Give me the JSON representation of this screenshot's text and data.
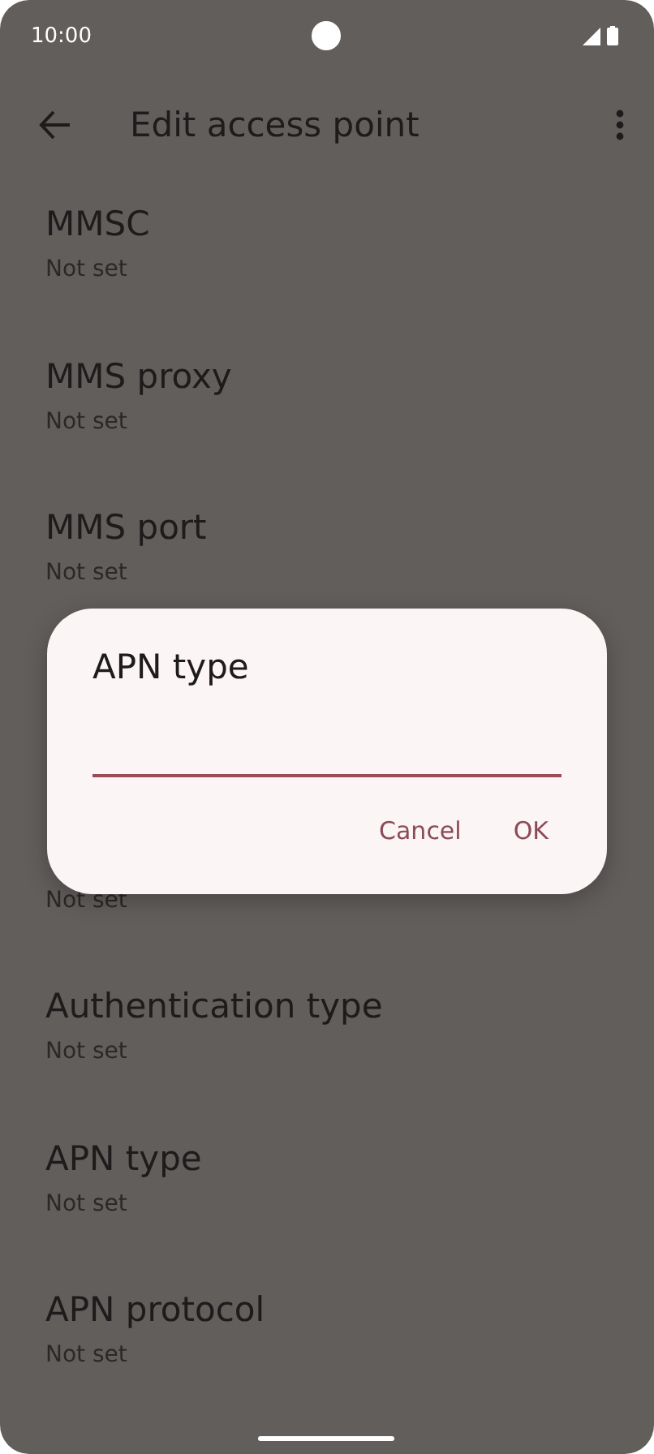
{
  "status_bar": {
    "time": "10:00"
  },
  "app_bar": {
    "title": "Edit access point"
  },
  "settings_above": [
    {
      "title": "MMSC",
      "summary": "Not set"
    },
    {
      "title": "MMS proxy",
      "summary": "Not set"
    },
    {
      "title": "MMS port",
      "summary": "Not set"
    }
  ],
  "settings_below": [
    {
      "summary": "Not set"
    },
    {
      "title": "Authentication type",
      "summary": "Not set"
    },
    {
      "title": "APN type",
      "summary": "Not set"
    },
    {
      "title": "APN protocol",
      "summary": "Not set"
    }
  ],
  "dialog": {
    "title": "APN type",
    "buttons": [
      "Cancel",
      "OK"
    ]
  }
}
